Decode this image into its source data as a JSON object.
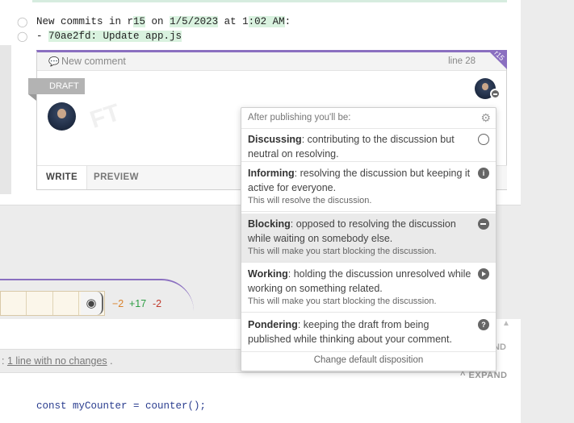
{
  "discussion": {
    "commit_prefix": "New commits in r",
    "commit_rev": "15",
    "commit_on": " on ",
    "commit_date": "1/5/2023",
    "commit_at": " at 1",
    "commit_time": ":02 AM",
    "commit_tail": ":",
    "commit_line_prefix": "- ",
    "commit_entry": "70ae2fd: Update app.js"
  },
  "comment": {
    "title": "New comment",
    "line_ref": "line 28",
    "corner_label": "r15",
    "draft_tag": "DRAFT",
    "draft_watermark": "FT",
    "tabs": [
      "WRITE",
      "PREVIEW"
    ]
  },
  "disposition": {
    "header": "After publishing you'll be:",
    "options": [
      {
        "name": "Discussing",
        "desc": ": contributing to the discussion but neutral on resolving.",
        "note": "",
        "icon": "empty-circle-icon"
      },
      {
        "name": "Informing",
        "desc": ": resolving the discussion but keeping it active for everyone.",
        "note": "This will resolve the discussion.",
        "icon": "info-icon"
      },
      {
        "name": "Blocking",
        "desc": ": opposed to resolving the discussion while waiting on somebody else.",
        "note": "This will make you start blocking the discussion.",
        "icon": "minus-circle-icon",
        "selected": true
      },
      {
        "name": "Working",
        "desc": ": holding the discussion unresolved while working on something related.",
        "note": "This will make you start blocking the discussion.",
        "icon": "play-circle-icon"
      },
      {
        "name": "Pondering",
        "desc": ": keeping the draft from being published while thinking about your comment.",
        "note": "",
        "icon": "question-icon"
      }
    ],
    "footer": "Change default disposition"
  },
  "diff": {
    "stats": [
      "−2",
      "+17",
      "-2"
    ],
    "no_change_prefix": ": ",
    "no_change_link": "1 line with no changes",
    "no_change_suffix": " .",
    "behind_label": "ND",
    "expand_label": "^ EXPAND",
    "code_line": "const myCounter = counter();"
  },
  "colors": {
    "accent": "#8a6fc0",
    "added": "#2e9e44",
    "removed": "#c0392b",
    "modified": "#d9822b"
  }
}
